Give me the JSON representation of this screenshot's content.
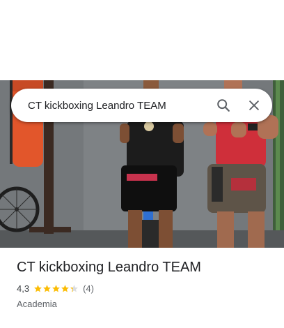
{
  "search": {
    "query": "CT kickboxing Leandro TEAM"
  },
  "place": {
    "title": "CT kickboxing Leandro TEAM",
    "rating": "4,3",
    "rating_numeric": 4.3,
    "stars_max": 5,
    "review_count": "(4)",
    "category": "Academia"
  },
  "colors": {
    "star": "#fbbc04",
    "star_empty": "#dadce0"
  }
}
